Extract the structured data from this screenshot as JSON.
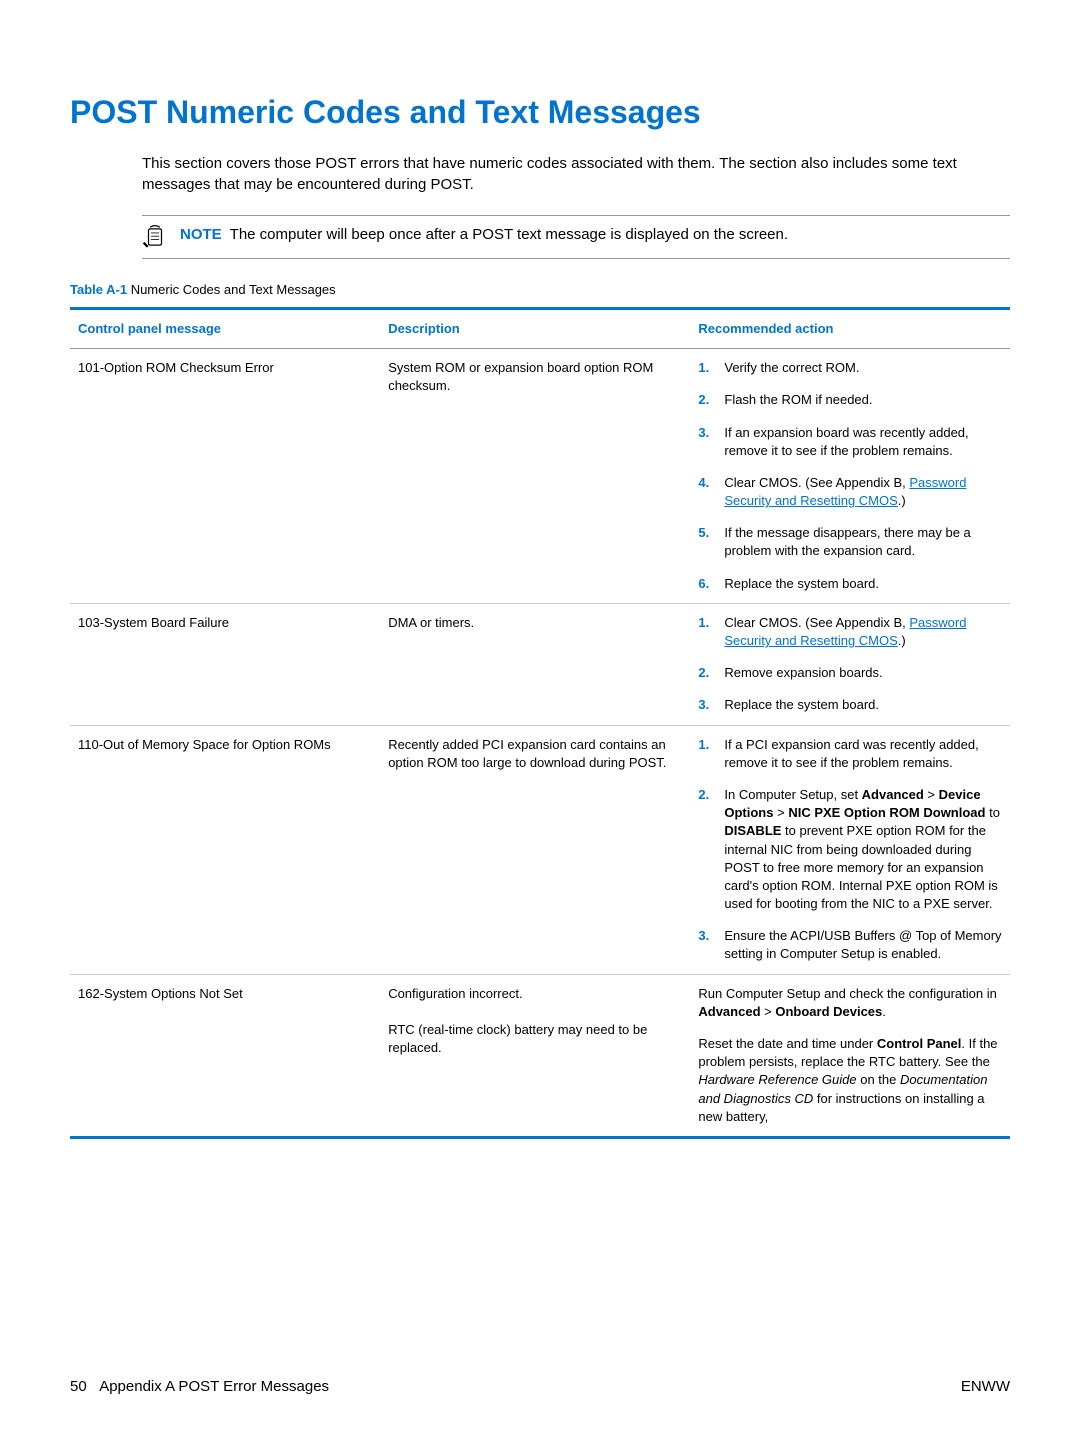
{
  "heading": "POST Numeric Codes and Text Messages",
  "intro": "This section covers those POST errors that have numeric codes associated with them. The section also includes some text messages that may be encountered during POST.",
  "note_label": "NOTE",
  "note_text": "The computer will beep once after a POST text message is displayed on the screen.",
  "table_caption_label": "Table A-1",
  "table_caption": " Numeric Codes and Text Messages",
  "headers": {
    "message": "Control panel message",
    "description": "Description",
    "action": "Recommended action"
  },
  "rows": [
    {
      "message": "101-Option ROM Checksum Error",
      "description": "System ROM or expansion board option ROM checksum.",
      "actions_list": [
        {
          "n": "1.",
          "text": "Verify the correct ROM."
        },
        {
          "n": "2.",
          "text": "Flash the ROM if needed."
        },
        {
          "n": "3.",
          "text": "If an expansion board was recently added, remove it to see if the problem remains."
        },
        {
          "n": "4.",
          "pre": "Clear CMOS. (See Appendix B, ",
          "link": "Password Security and Resetting CMOS",
          "post": ".)"
        },
        {
          "n": "5.",
          "text": "If the message disappears, there may be a problem with the expansion card."
        },
        {
          "n": "6.",
          "text": "Replace the system board."
        }
      ]
    },
    {
      "message": "103-System Board Failure",
      "description": "DMA or timers.",
      "actions_list": [
        {
          "n": "1.",
          "pre": "Clear CMOS. (See Appendix B, ",
          "link": "Password Security and Resetting CMOS",
          "post": ".)"
        },
        {
          "n": "2.",
          "text": "Remove expansion boards."
        },
        {
          "n": "3.",
          "text": "Replace the system board."
        }
      ]
    },
    {
      "message": "110-Out of Memory Space for Option ROMs",
      "description": "Recently added PCI expansion card contains an option ROM too large to download during POST.",
      "actions_list": [
        {
          "n": "1.",
          "text": "If a PCI expansion card was recently added, remove it to see if the problem remains."
        },
        {
          "n": "2.",
          "html": "In Computer Setup, set <span class='bold'>Advanced</span> > <span class='bold'>Device Options</span> > <span class='bold'>NIC PXE Option ROM Download</span> to <span class='bold'>DISABLE</span> to prevent PXE option ROM for the internal NIC from being downloaded during POST to free more memory for an expansion card's option ROM. Internal PXE option ROM is used for booting from the NIC to a PXE server."
        },
        {
          "n": "3.",
          "text": "Ensure the ACPI/USB Buffers @ Top of Memory setting in Computer Setup is enabled."
        }
      ]
    },
    {
      "message": "162-System Options Not Set",
      "description_html": "Configuration incorrect.<br><br>RTC (real-time clock) battery may need to be replaced.",
      "actions_paras": [
        "Run Computer Setup and check the configuration in <span class='bold'>Advanced</span> > <span class='bold'>Onboard Devices</span>.",
        "Reset the date and time under <span class='bold'>Control Panel</span>. If the problem persists, replace the RTC battery. See the <span class='italic'>Hardware Reference Guide</span> on the <span class='italic'>Documentation and Diagnostics CD</span> for instructions on installing a new battery,"
      ]
    }
  ],
  "footer": {
    "page": "50",
    "left": "Appendix A   POST Error Messages",
    "right": "ENWW"
  }
}
